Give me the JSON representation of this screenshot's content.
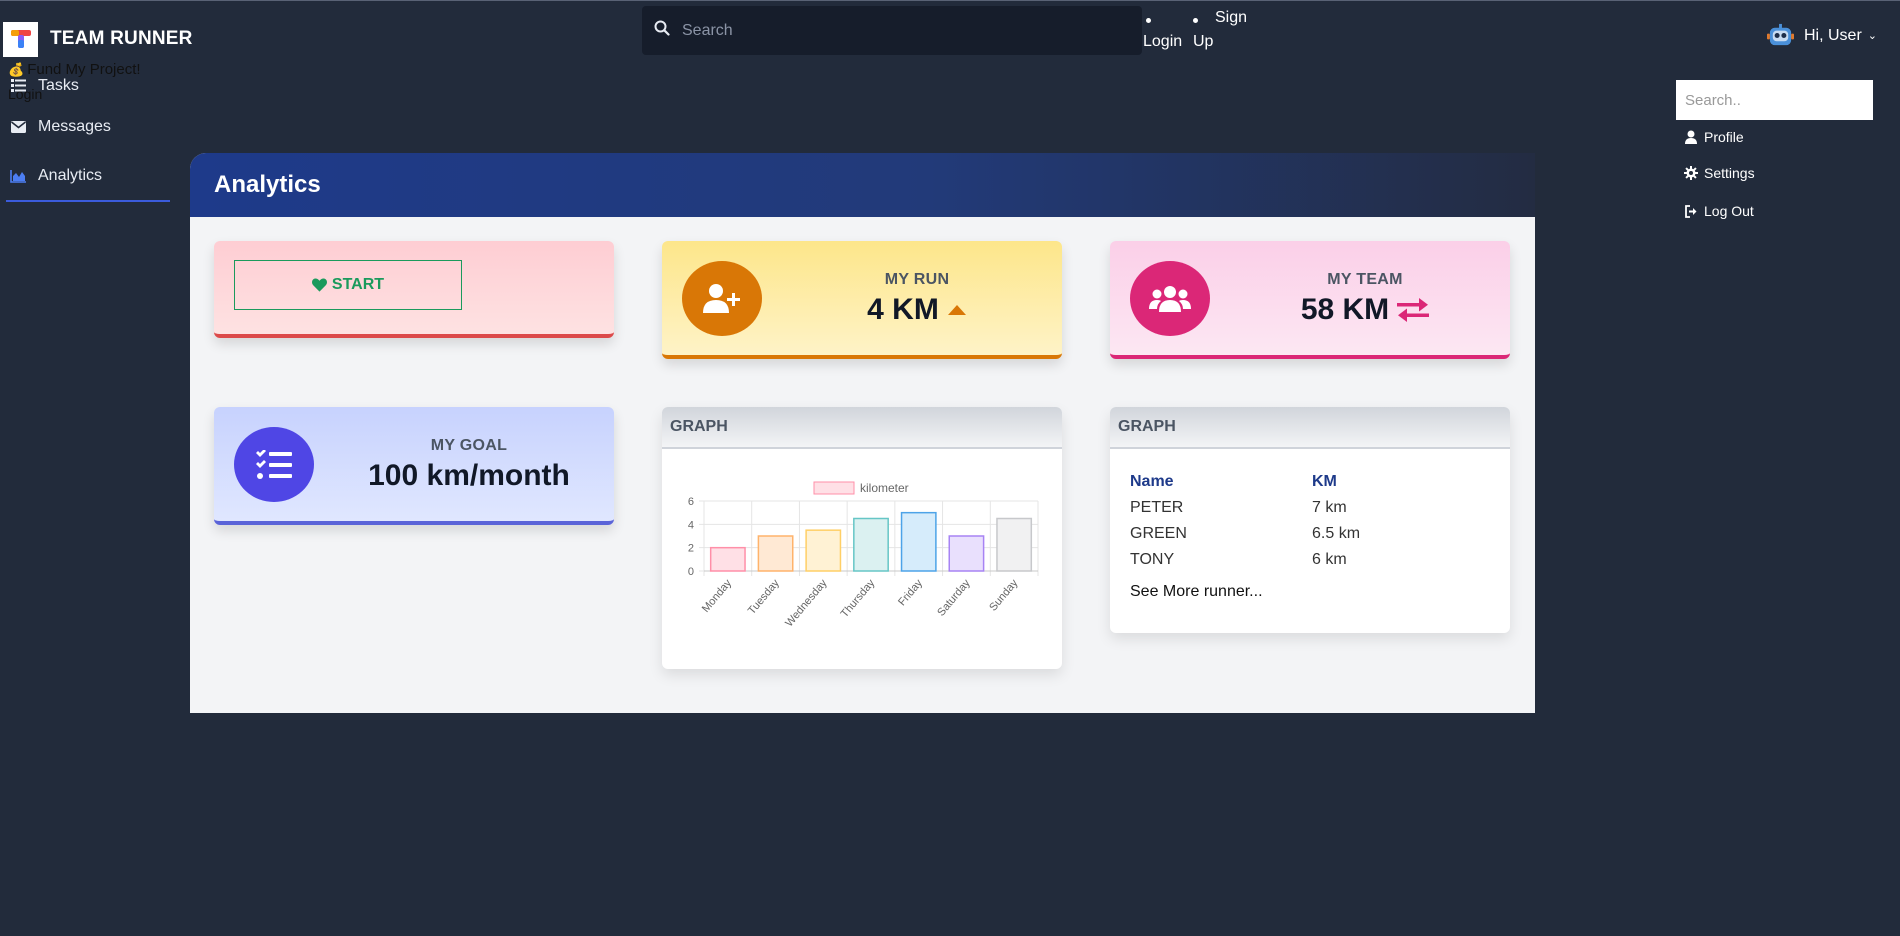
{
  "brand": {
    "name": "TEAM RUNNER"
  },
  "fund": {
    "label": "Fund My Project!",
    "sub": "Login"
  },
  "nav": {
    "items": [
      {
        "label": "Tasks",
        "icon": "list-icon"
      },
      {
        "label": "Messages",
        "icon": "envelope-icon"
      },
      {
        "label": "Analytics",
        "icon": "chart-area-icon",
        "active": true
      }
    ]
  },
  "search": {
    "placeholder": "Search"
  },
  "auth": {
    "login": "Login",
    "sign": "Sign",
    "up": "Up"
  },
  "user": {
    "greeting": "Hi, User",
    "chevron": "⌄"
  },
  "user_menu": {
    "search_placeholder": "Search..",
    "items": [
      {
        "label": "Profile",
        "icon": "user-icon"
      },
      {
        "label": "Settings",
        "icon": "gear-icon"
      },
      {
        "label": "Log Out",
        "icon": "sign-out-icon"
      }
    ]
  },
  "main": {
    "title": "Analytics",
    "start_label": "START",
    "run": {
      "label": "MY RUN",
      "value": "4 KM"
    },
    "team": {
      "label": "MY TEAM",
      "value": "58 KM"
    },
    "goal": {
      "label": "MY GOAL",
      "value": "100 km/month"
    },
    "graph_title": "GRAPH",
    "table_title": "GRAPH",
    "table": {
      "headers": [
        "Name",
        "KM"
      ],
      "rows": [
        [
          "PETER",
          "7 km"
        ],
        [
          "GREEN",
          "6.5 km"
        ],
        [
          "TONY",
          "6 km"
        ]
      ],
      "see_more": "See More runner..."
    }
  },
  "colors": {
    "background": "#222b3b",
    "accent": "#3b5bdb",
    "start_green": "#1b9a5c",
    "run_orange": "#d97706",
    "team_pink": "#db2777",
    "goal_indigo": "#4f46e5"
  },
  "chart_data": {
    "type": "bar",
    "categories": [
      "Monday",
      "Tuesday",
      "Wednesday",
      "Thursday",
      "Friday",
      "Saturday",
      "Sunday"
    ],
    "series": [
      {
        "name": "kilometer",
        "values": [
          2,
          3,
          3.5,
          4.5,
          5,
          3,
          4.5
        ]
      }
    ],
    "ylim": [
      0,
      6
    ],
    "yticks": [
      0,
      2,
      4,
      6
    ],
    "grid": true,
    "legend": "top",
    "bar_fills": [
      "#ffe0e6",
      "#ffe9d4",
      "#fff2d4",
      "#dbf1f1",
      "#d6ecfb",
      "#e9e0fd",
      "#f1f1f2"
    ],
    "bar_strokes": [
      "#ff8fa8",
      "#ffb36b",
      "#ffcf66",
      "#66c6c6",
      "#4da3e8",
      "#a783f4",
      "#c7c8cb"
    ]
  }
}
